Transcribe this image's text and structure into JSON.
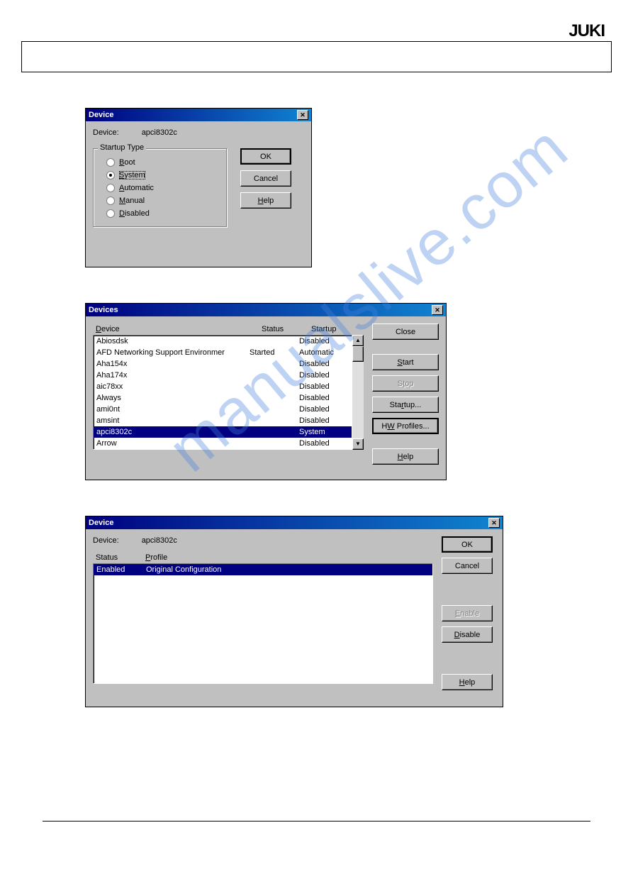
{
  "brand": "JUKI",
  "watermark": "manualslive.com",
  "dialog1": {
    "title": "Device",
    "device_label": "Device:",
    "device_value": "apci8302c",
    "group_title": "Startup Type",
    "options": [
      {
        "label": "Boot",
        "selected": false
      },
      {
        "label": "System",
        "selected": true
      },
      {
        "label": "Automatic",
        "selected": false
      },
      {
        "label": "Manual",
        "selected": false
      },
      {
        "label": "Disabled",
        "selected": false
      }
    ],
    "buttons": {
      "ok": "OK",
      "cancel": "Cancel",
      "help": "Help"
    }
  },
  "dialog2": {
    "title": "Devices",
    "headers": {
      "device": "Device",
      "status": "Status",
      "startup": "Startup"
    },
    "rows": [
      {
        "device": "Abiosdsk",
        "status": "",
        "startup": "Disabled",
        "selected": false
      },
      {
        "device": "AFD Networking Support Environmer",
        "status": "Started",
        "startup": "Automatic",
        "selected": false
      },
      {
        "device": "Aha154x",
        "status": "",
        "startup": "Disabled",
        "selected": false
      },
      {
        "device": "Aha174x",
        "status": "",
        "startup": "Disabled",
        "selected": false
      },
      {
        "device": "aic78xx",
        "status": "",
        "startup": "Disabled",
        "selected": false
      },
      {
        "device": "Always",
        "status": "",
        "startup": "Disabled",
        "selected": false
      },
      {
        "device": "ami0nt",
        "status": "",
        "startup": "Disabled",
        "selected": false
      },
      {
        "device": "amsint",
        "status": "",
        "startup": "Disabled",
        "selected": false
      },
      {
        "device": "apci8302c",
        "status": "",
        "startup": "System",
        "selected": true
      },
      {
        "device": "Arrow",
        "status": "",
        "startup": "Disabled",
        "selected": false
      }
    ],
    "buttons": {
      "close": "Close",
      "start": "Start",
      "stop": "Stop",
      "startup": "Startup...",
      "hwprofiles": "HW Profiles...",
      "help": "Help"
    }
  },
  "dialog3": {
    "title": "Device",
    "device_label": "Device:",
    "device_value": "apci8302c",
    "headers": {
      "status": "Status",
      "profile": "Profile"
    },
    "rows": [
      {
        "status": "Enabled",
        "profile": "Original Configuration",
        "selected": true
      }
    ],
    "buttons": {
      "ok": "OK",
      "cancel": "Cancel",
      "enable": "Enable",
      "disable": "Disable",
      "help": "Help"
    }
  }
}
